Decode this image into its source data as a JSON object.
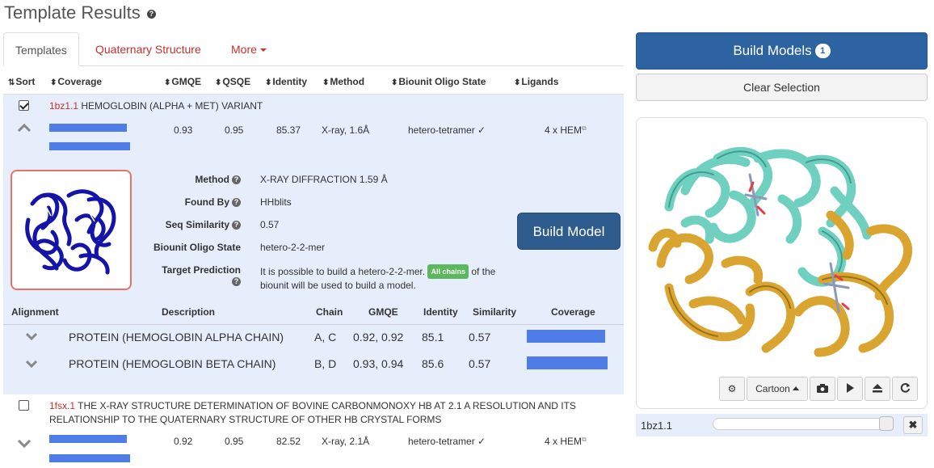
{
  "page": {
    "title": "Template Results",
    "help": "?"
  },
  "tabs": [
    {
      "label": "Templates",
      "active": true
    },
    {
      "label": "Quaternary Structure"
    },
    {
      "label": "More"
    }
  ],
  "columns": {
    "sort": "Sort",
    "coverage": "Coverage",
    "gmqe": "GMQE",
    "qsqe": "QSQE",
    "identity": "Identity",
    "method": "Method",
    "oligo": "Biounit Oligo State",
    "ligands": "Ligands"
  },
  "templates": [
    {
      "checked": true,
      "id": "1bz1.1",
      "name": "HEMOGLOBIN (ALPHA + MET) VARIANT",
      "gmqe": "0.93",
      "qsqe": "0.95",
      "identity": "85.37",
      "method": "X-ray, 1.6Å",
      "oligo": "hetero-tetramer ✓",
      "ligands": "4 x HEM",
      "coverage": [
        0.96,
        1.0
      ]
    },
    {
      "checked": false,
      "id": "1fsx.1",
      "name_line1": "THE X-RAY STRUCTURE DETERMINATION OF BOVINE CARBONMONOXY HB AT 2.1 A RESOLUTION AND ITS",
      "name_line2": "RELATIONSHIP TO THE QUATERNARY STRUCTURE OF OTHER HB CRYSTAL FORMS",
      "gmqe": "0.92",
      "qsqe": "0.95",
      "identity": "82.52",
      "method": "X-ray, 2.1Å",
      "oligo": "hetero-tetramer ✓",
      "ligands": "4 x HEM",
      "coverage": [
        0.96,
        1.0
      ]
    }
  ],
  "details": {
    "method_label": "Method",
    "method_value": "X-RAY DIFFRACTION 1.59 Å",
    "found_label": "Found By",
    "found_value": "HHblits",
    "seqsim_label": "Seq Similarity",
    "seqsim_value": "0.57",
    "oligo_label": "Biounit Oligo State",
    "oligo_value": "hetero-2-2-mer",
    "target_label": "Target Prediction",
    "target_text1": "It is possible to build a hetero-2-2-mer.",
    "all_chains": "All chains",
    "target_text2": "of the",
    "target_text3": "biounit will be used to build a model.",
    "build_button": "Build Model"
  },
  "alignment": {
    "headers": {
      "alignment": "Alignment",
      "description": "Description",
      "chain": "Chain",
      "gmqe": "GMQE",
      "identity": "Identity",
      "similarity": "Similarity",
      "coverage": "Coverage"
    },
    "rows": [
      {
        "description": "PROTEIN (HEMOGLOBIN ALPHA CHAIN)",
        "chain": "A, C",
        "gmqe": "0.92, 0.92",
        "identity": "85.1",
        "similarity": "0.57",
        "coverage": 0.97
      },
      {
        "description": "PROTEIN (HEMOGLOBIN BETA CHAIN)",
        "chain": "B, D",
        "gmqe": "0.93, 0.94",
        "identity": "85.6",
        "similarity": "0.57",
        "coverage": 1.0
      }
    ]
  },
  "right": {
    "build_models": "Build Models",
    "build_count": "1",
    "clear_selection": "Clear Selection",
    "style_label": "Cartoon",
    "model_name": "1bz1.1",
    "model_opacity": 0.98
  },
  "colors": {
    "link": "#c9302c",
    "bar": "#4f7de8",
    "primary": "#2e63a1",
    "selected_bg": "#e6eefb",
    "chainA": "#6fd0c0",
    "chainB": "#d9a530",
    "thumb": "#1414a8"
  }
}
